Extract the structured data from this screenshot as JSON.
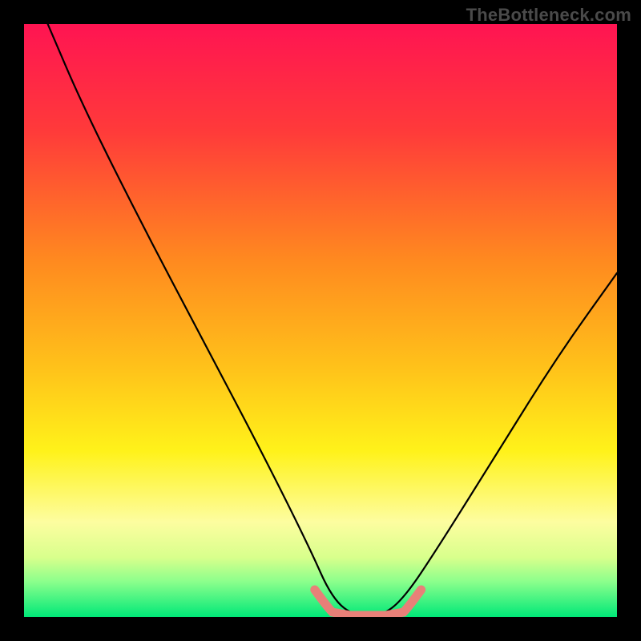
{
  "watermark": {
    "text": "TheBottleneck.com"
  },
  "colors": {
    "frame": "#000000",
    "gradient_stops": [
      {
        "offset": 0.0,
        "color": "#ff1452"
      },
      {
        "offset": 0.18,
        "color": "#ff3a3a"
      },
      {
        "offset": 0.4,
        "color": "#ff8a1f"
      },
      {
        "offset": 0.58,
        "color": "#ffc21a"
      },
      {
        "offset": 0.72,
        "color": "#fff21a"
      },
      {
        "offset": 0.84,
        "color": "#fdfda0"
      },
      {
        "offset": 0.9,
        "color": "#d8ff8c"
      },
      {
        "offset": 0.94,
        "color": "#8cff8c"
      },
      {
        "offset": 1.0,
        "color": "#00e878"
      }
    ],
    "curve": "#000000",
    "valley_highlight": "#e88078"
  },
  "chart_data": {
    "type": "line",
    "title": "",
    "xlabel": "",
    "ylabel": "",
    "xlim": [
      0,
      100
    ],
    "ylim": [
      0,
      100
    ],
    "series": [
      {
        "name": "bottleneck-curve",
        "x": [
          4,
          10,
          20,
          30,
          40,
          48,
          52,
          56,
          60,
          64,
          70,
          80,
          90,
          100
        ],
        "y": [
          100,
          86,
          66,
          47,
          28,
          12,
          3,
          0,
          0,
          3,
          12,
          28,
          44,
          58
        ]
      }
    ],
    "annotations": [
      {
        "name": "valley-flat",
        "x_start": 52,
        "x_end": 64,
        "y": 0
      }
    ]
  }
}
